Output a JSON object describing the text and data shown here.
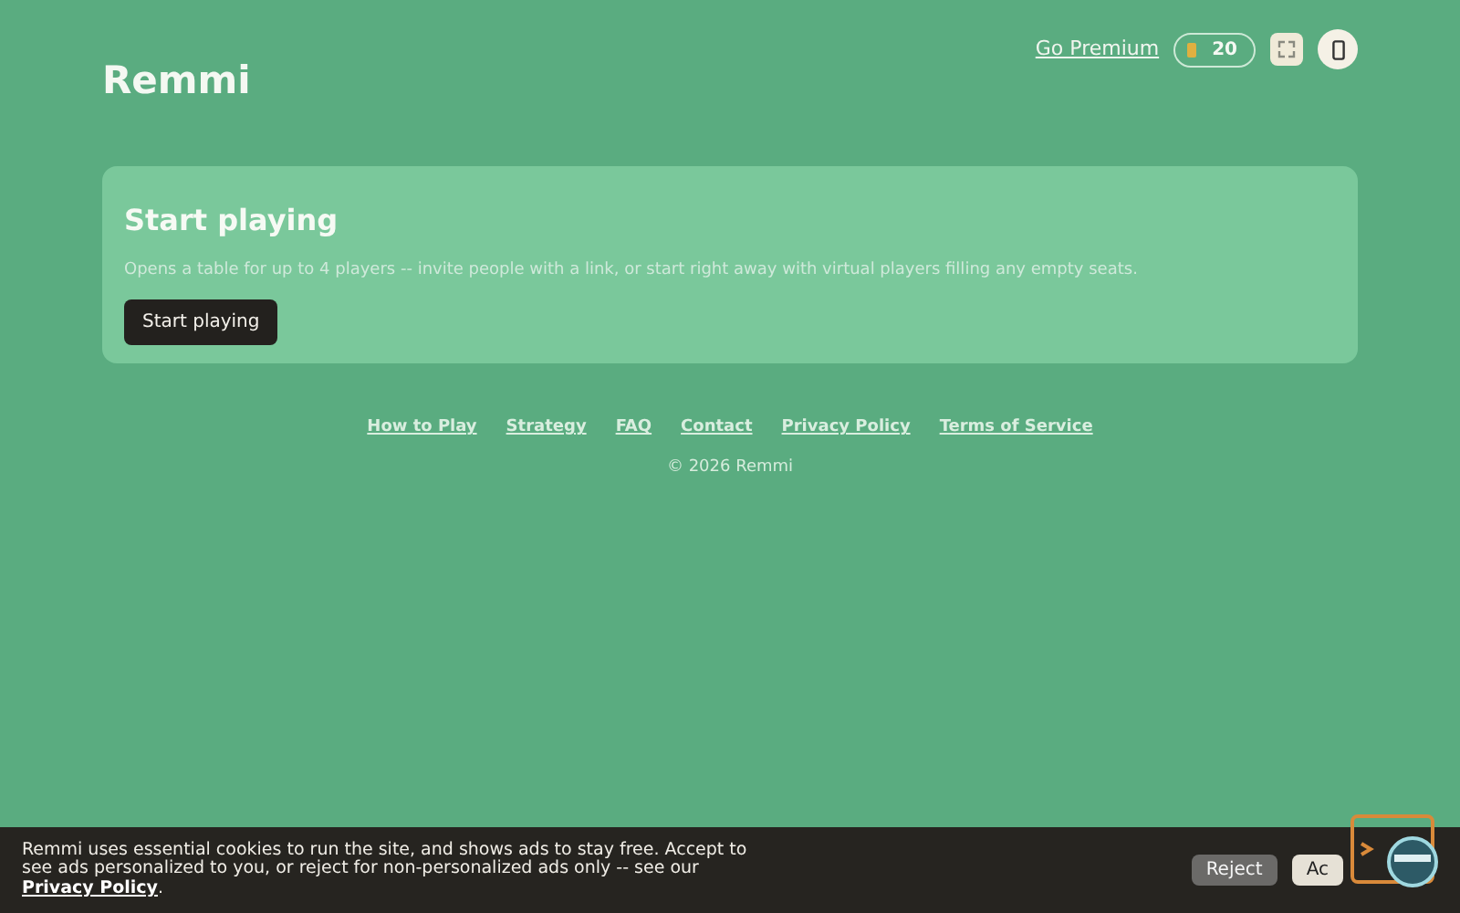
{
  "header": {
    "brand": "Remmi",
    "premium_link": "Go Premium",
    "coins": "20"
  },
  "card": {
    "title": "Start playing",
    "description": "Opens a table for up to 4 players -- invite people with a link, or start right away with virtual players filling any empty seats.",
    "button": "Start playing"
  },
  "footer": {
    "links": [
      "How to Play",
      "Strategy",
      "FAQ",
      "Contact",
      "Privacy Policy",
      "Terms of Service"
    ],
    "copyright": "© 2026 Remmi"
  },
  "cookie_bar": {
    "text": "Remmi uses essential cookies to run the site, and shows ads to stay free. Accept to see ads personalized to you, or reject for non-personalized ads only -- see our ",
    "link": "Privacy Policy",
    "after": ".",
    "buttons": [
      "Reject",
      "Ac"
    ]
  }
}
